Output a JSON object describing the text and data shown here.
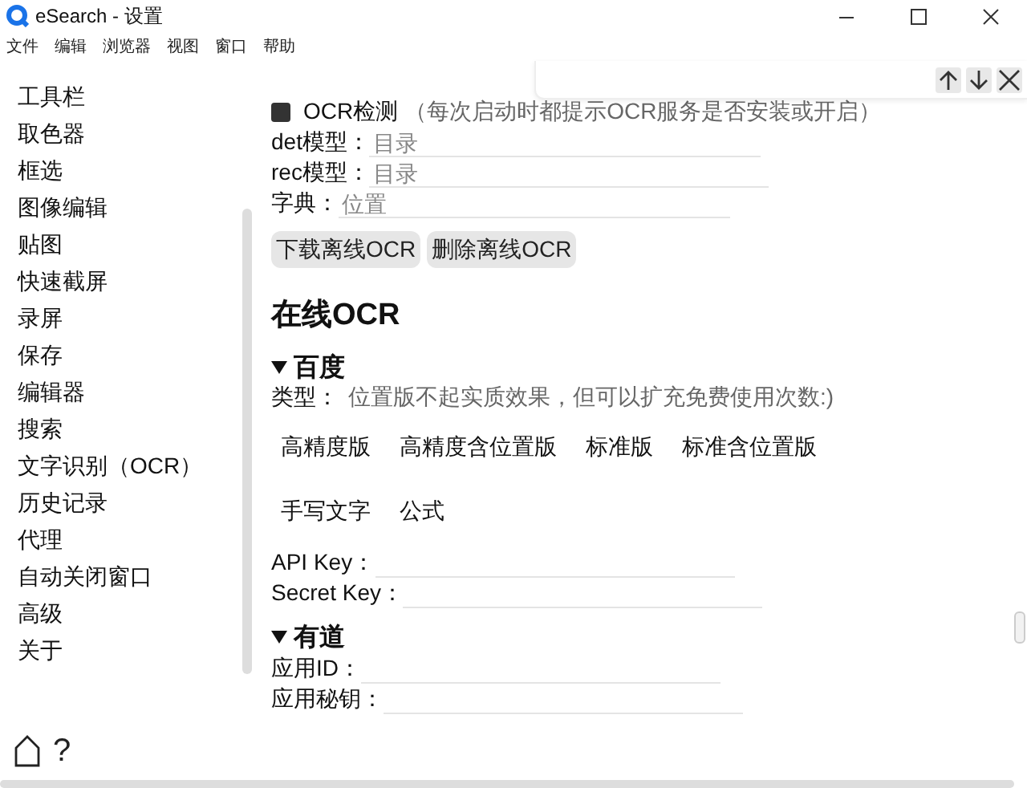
{
  "window": {
    "title": "eSearch - 设置"
  },
  "menu": [
    "文件",
    "编辑",
    "浏览器",
    "视图",
    "窗口",
    "帮助"
  ],
  "sidebar": {
    "items": [
      "工具栏",
      "取色器",
      "框选",
      "图像编辑",
      "贴图",
      "快速截屏",
      "录屏",
      "保存",
      "编辑器",
      "搜索",
      "文字识别（OCR）",
      "历史记录",
      "代理",
      "自动关闭窗口",
      "高级",
      "关于"
    ]
  },
  "offline_ocr": {
    "check": {
      "label": "OCR检测",
      "hint": "（每次启动时都提示OCR服务是否安装或开启）",
      "checked": true
    },
    "fields": [
      {
        "label": "det模型：",
        "placeholder": "目录"
      },
      {
        "label": "rec模型：",
        "placeholder": "目录"
      },
      {
        "label": "字典：",
        "placeholder": "位置"
      }
    ],
    "buttons": [
      "下载离线OCR",
      "删除离线OCR"
    ]
  },
  "online_ocr": {
    "title": "在线OCR",
    "providers": [
      {
        "name": "百度",
        "expanded": true,
        "type_label": "类型：",
        "type_hint": "位置版不起实质效果，但可以扩充免费使用次数:)",
        "options": [
          "高精度版",
          "高精度含位置版",
          "标准版",
          "标准含位置版",
          "手写文字",
          "公式"
        ],
        "fields": [
          {
            "label": "API Key："
          },
          {
            "label": "Secret Key："
          }
        ]
      },
      {
        "name": "有道",
        "expanded": true,
        "fields": [
          {
            "label": "应用ID："
          },
          {
            "label": "应用秘钥："
          }
        ]
      }
    ]
  },
  "footer": {
    "help": "?"
  }
}
